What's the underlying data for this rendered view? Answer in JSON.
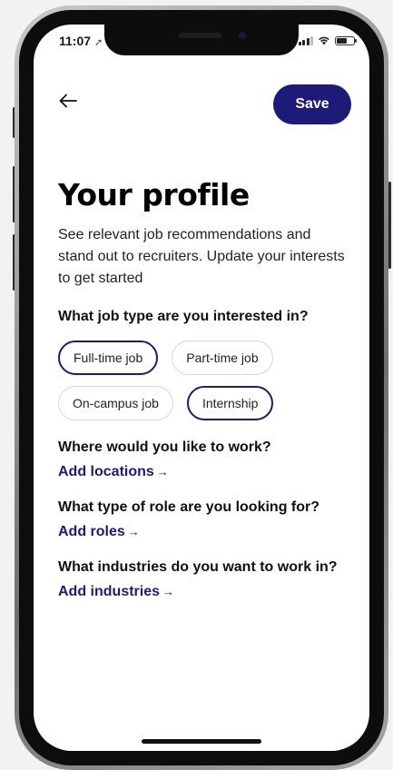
{
  "status_bar": {
    "time": "11:07",
    "location_icon": "location-arrow-icon",
    "signal_icon": "cellular-signal-icon",
    "wifi_icon": "wifi-icon",
    "battery_icon": "battery-icon"
  },
  "header": {
    "back_icon": "arrow-left-icon",
    "save_label": "Save"
  },
  "page": {
    "title": "Your profile",
    "subtitle": "See relevant job recommendations and stand out to recruiters. Update your interests to get started"
  },
  "job_type": {
    "question": "What job type are you interested in?",
    "options": [
      {
        "label": "Full-time job",
        "selected": true
      },
      {
        "label": "Part-time job",
        "selected": false
      },
      {
        "label": "On-campus job",
        "selected": false
      },
      {
        "label": "Internship",
        "selected": true
      }
    ]
  },
  "locations": {
    "question": "Where would you like to work?",
    "link": "Add locations",
    "arrow": "→"
  },
  "roles": {
    "question": "What type of role are you looking for?",
    "link": "Add roles",
    "arrow": "→"
  },
  "industries": {
    "question": "What industries do you want to work in?",
    "link": "Add industries",
    "arrow": "→"
  },
  "colors": {
    "accent": "#1d1a7a",
    "chip_border": "#d7d7d7",
    "text": "#111111",
    "background": "#ffffff"
  }
}
